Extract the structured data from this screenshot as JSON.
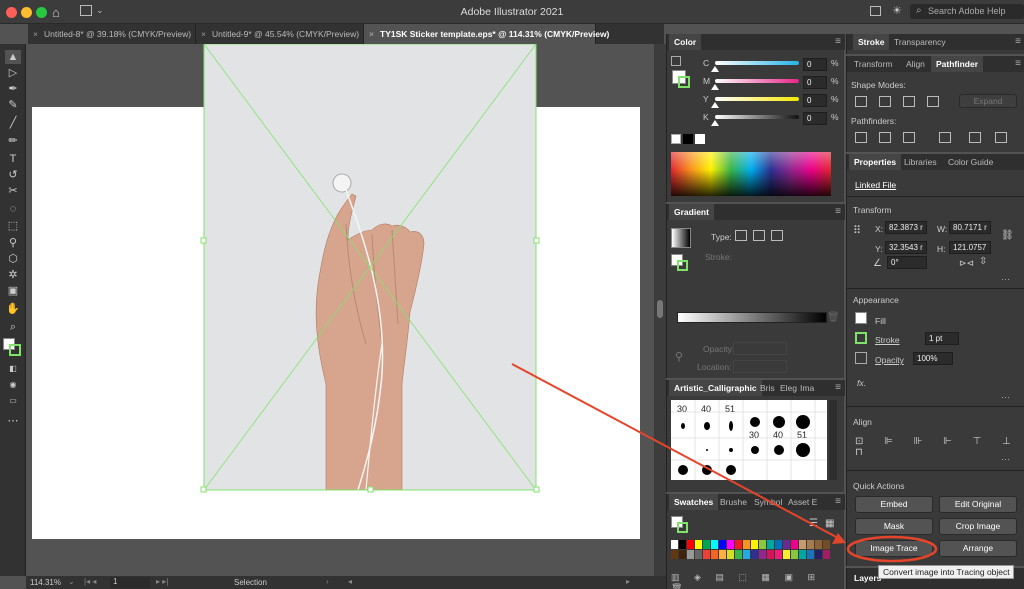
{
  "app": {
    "title": "Adobe Illustrator 2021",
    "search_placeholder": "Search Adobe Help"
  },
  "tabs": [
    {
      "label": "Untitled-8* @ 39.18% (CMYK/Preview)"
    },
    {
      "label": "Untitled-9* @ 45.54% (CMYK/Preview)"
    },
    {
      "label": "TY1SK Sticker template.eps* @ 114.31% (CMYK/Preview)"
    }
  ],
  "status": {
    "zoom": "114.31%",
    "page": "1",
    "mode": "Selection"
  },
  "color_panel": {
    "title": "Color",
    "channels": [
      {
        "key": "C",
        "value": "0",
        "unit": "%",
        "grad": "#23b4e8"
      },
      {
        "key": "M",
        "value": "0",
        "unit": "%",
        "grad": "#e6258a"
      },
      {
        "key": "Y",
        "value": "0",
        "unit": "%",
        "grad": "#f3e600"
      },
      {
        "key": "K",
        "value": "0",
        "unit": "%",
        "grad": "#111111"
      }
    ]
  },
  "gradient_panel": {
    "title": "Gradient",
    "type_label": "Type:",
    "stroke_label": "Stroke:",
    "opacity_label": "Opacity:",
    "location_label": "Location:"
  },
  "brushes_panel": {
    "tabs": [
      "Artistic_Calligraphic",
      "Bris",
      "Eleg",
      "Ima"
    ],
    "size_labels": [
      "30",
      "40",
      "51",
      "30",
      "40",
      "51"
    ]
  },
  "swatches_panel": {
    "tabs": [
      "Swatches",
      "Brushe",
      "Symbol",
      "Asset E"
    ]
  },
  "stroke_panel": {
    "tabs": [
      "Stroke",
      "Transparency"
    ]
  },
  "transform_group": {
    "tabs": [
      "Transform",
      "Align",
      "Pathfinder"
    ]
  },
  "pathfinder": {
    "shape_modes": "Shape Modes:",
    "pathfinders": "Pathfinders:",
    "expand": "Expand"
  },
  "properties_tabs": [
    "Properties",
    "Libraries",
    "Color Guide"
  ],
  "properties": {
    "object_type": "Linked File",
    "transform_title": "Transform",
    "x_label": "X:",
    "x_value": "82.3873 r",
    "y_label": "Y:",
    "y_value": "32.3543 r",
    "w_label": "W:",
    "w_value": "80.7171 r",
    "h_label": "H:",
    "h_value": "121.0757",
    "angle_value": "0°",
    "appearance_title": "Appearance",
    "fill_label": "Fill",
    "stroke_label": "Stroke",
    "stroke_value": "1 pt",
    "opacity_label": "Opacity",
    "opacity_value": "100%",
    "fx_label": "fx.",
    "align_title": "Align",
    "quick_actions_title": "Quick Actions",
    "buttons": {
      "embed": "Embed",
      "edit_original": "Edit Original",
      "mask": "Mask",
      "crop_image": "Crop Image",
      "image_trace": "Image Trace",
      "arrange": "Arrange"
    },
    "tooltip": "Convert image into Tracing object",
    "layers": "Layers"
  },
  "colors": {
    "accent_annotation": "#e5452a",
    "selection_green": "#7fe36a"
  },
  "swatch_colors": [
    "#ffffff",
    "#000000",
    "#ff0000",
    "#ffff00",
    "#00a651",
    "#00ffff",
    "#0000ff",
    "#ff00ff",
    "#ed1c24",
    "#f7941d",
    "#fff200",
    "#8dc63f",
    "#00a99d",
    "#0072bc",
    "#662d91",
    "#ec008c",
    "#c69c6d",
    "#a67c52",
    "#8c6239",
    "#754c24",
    "#603913",
    "#42210b",
    "#999999",
    "#666666",
    "#ee4036",
    "#f26522",
    "#fbb040",
    "#d7df23",
    "#39b54a",
    "#27aae1",
    "#2e3192",
    "#92278f",
    "#d4145a",
    "#ed1e79",
    "#f9ed32",
    "#8bc53f",
    "#00a79d",
    "#1b75bc",
    "#262262",
    "#9e1f63"
  ]
}
